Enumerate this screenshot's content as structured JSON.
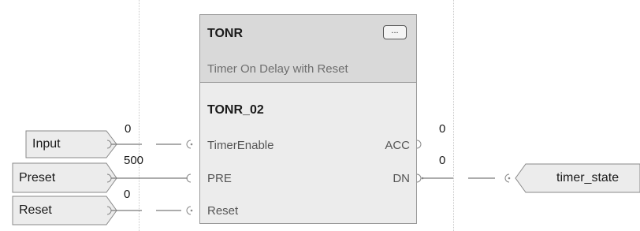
{
  "block": {
    "type": "TONR",
    "description": "Timer On Delay with Reset",
    "instance": "TONR_02",
    "more_label": "...",
    "inputs": [
      {
        "pin": "TimerEnable",
        "tag": "Input",
        "value": "0"
      },
      {
        "pin": "PRE",
        "tag": "Preset",
        "value": "500"
      },
      {
        "pin": "Reset",
        "tag": "Reset",
        "value": "0"
      }
    ],
    "outputs": [
      {
        "pin": "ACC",
        "value": "0"
      },
      {
        "pin": "DN",
        "value": "0",
        "tag": "timer_state"
      }
    ]
  },
  "colors": {
    "wire": "#7a7a7a",
    "block_header": "#d9d9d9",
    "block_body": "#ececec",
    "tag_fill": "#ececec"
  }
}
